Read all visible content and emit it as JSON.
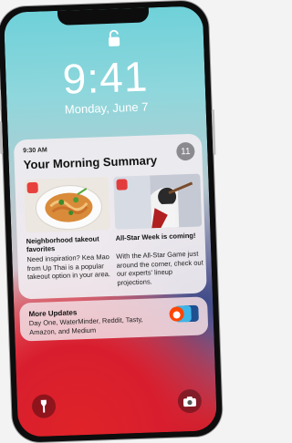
{
  "lock_screen": {
    "time": "9:41",
    "date": "Monday, June 7"
  },
  "summary": {
    "time": "9:30 AM",
    "title": "Your Morning Summary",
    "count": "11",
    "stories": [
      {
        "title": "Neighborhood takeout favorites",
        "body": "Need inspiration? Kea Mao from Up Thai is a popular takeout option in your area."
      },
      {
        "title": "All-Star Week is coming!",
        "body": "With the All-Star Game just around the corner, check out our experts' lineup projections."
      }
    ]
  },
  "more_updates": {
    "title": "More Updates",
    "text": "Day One, WaterMinder, Reddit, Tasty, Amazon, and Medium"
  },
  "colors": {
    "accent_red": "#e02328",
    "wallpaper_teal": "#6fd1d9"
  },
  "icons": [
    "lock-icon",
    "flashlight-icon",
    "camera-icon"
  ]
}
